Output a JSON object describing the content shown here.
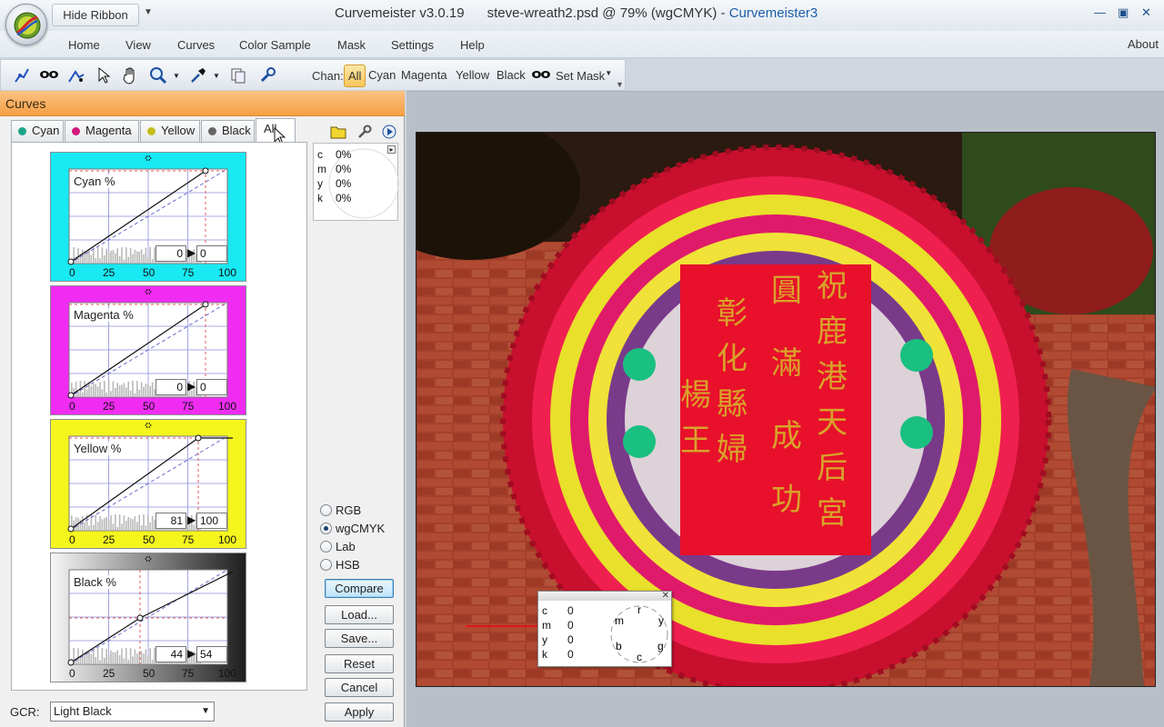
{
  "titlebar": {
    "hide_ribbon": "Hide Ribbon",
    "title_main": "Curvemeister v3.0.19      steve-wreath2.psd @ 79% (wgCMYK) - ",
    "title_brand": "Curvemeister3",
    "minimize": "—",
    "maximize": "▣",
    "close": "✕"
  },
  "menu": {
    "items": [
      "Home",
      "View",
      "Curves",
      "Color Sample",
      "Mask",
      "Settings",
      "Help"
    ],
    "about": "About"
  },
  "toolbar": {
    "chan_label": "Chan:",
    "channels": [
      "All",
      "Cyan",
      "Magenta",
      "Yellow",
      "Black"
    ],
    "active_channel": "All",
    "set_mask": "Set Mask",
    "icons": [
      "curve-pen-icon",
      "mask-icon",
      "sample-tool-icon",
      "pointer-icon",
      "hand-icon",
      "zoom-icon",
      "eyedropper-icon",
      "copy-icon",
      "wrench-icon"
    ]
  },
  "panel": {
    "title": "Curves",
    "tabs": [
      "Cyan",
      "Magenta",
      "Yellow",
      "Black",
      "All"
    ],
    "active_tab": "All",
    "tab_colors": [
      "#1aa58a",
      "#d0197f",
      "#c4be1c",
      "#666666"
    ],
    "axis_ticks": [
      "0",
      "25",
      "50",
      "75",
      "100"
    ],
    "graphs": [
      {
        "label": "Cyan %",
        "in": "0",
        "out": "0",
        "color": "#19e9f2"
      },
      {
        "label": "Magenta %",
        "in": "0",
        "out": "0",
        "color": "#f02cf2"
      },
      {
        "label": "Yellow %",
        "in": "81",
        "out": "100",
        "color": "#f5f51e"
      },
      {
        "label": "Black %",
        "in": "44",
        "out": "54",
        "color": "#2b2b2b"
      }
    ],
    "readout": [
      {
        "k": "c",
        "v": "0%"
      },
      {
        "k": "m",
        "v": "0%"
      },
      {
        "k": "y",
        "v": "0%"
      },
      {
        "k": "k",
        "v": "0%"
      }
    ],
    "color_modes": [
      "RGB",
      "wgCMYK",
      "Lab",
      "HSB"
    ],
    "selected_mode": "wgCMYK",
    "buttons": {
      "compare": "Compare",
      "load": "Load...",
      "save": "Save...",
      "reset": "Reset",
      "cancel": "Cancel",
      "apply": "Apply"
    },
    "gcr": {
      "label": "GCR:",
      "value": "Light Black"
    }
  },
  "sampler": {
    "rows": [
      {
        "k": "c",
        "v": "0"
      },
      {
        "k": "m",
        "v": "0"
      },
      {
        "k": "y",
        "v": "0"
      },
      {
        "k": "k",
        "v": "0"
      }
    ],
    "wheel": [
      "r",
      "m",
      "y",
      "b",
      "g",
      "c"
    ]
  }
}
